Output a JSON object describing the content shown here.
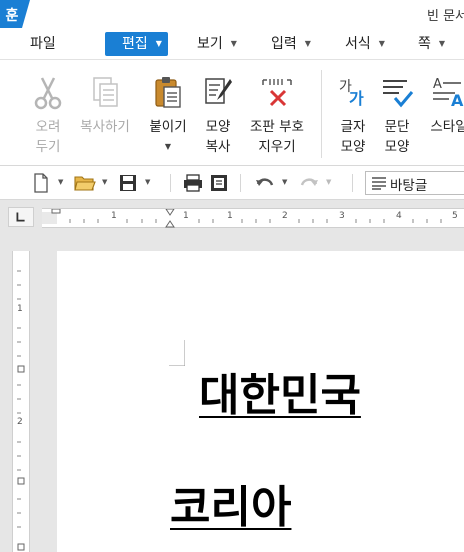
{
  "app": {
    "logo_letter": "훈",
    "window_title": "빈 문서"
  },
  "menu": {
    "items": [
      {
        "label": "파일",
        "has_caret": false
      },
      {
        "label": "편집",
        "has_caret": true,
        "active": true
      },
      {
        "label": "보기",
        "has_caret": true
      },
      {
        "label": "입력",
        "has_caret": true
      },
      {
        "label": "서식",
        "has_caret": true
      },
      {
        "label": "쪽",
        "has_caret": true
      }
    ]
  },
  "ribbon": {
    "buttons": [
      {
        "label": "오려\n두기",
        "icon": "scissors-icon",
        "disabled": true,
        "dropdown": false
      },
      {
        "label": "복사하기",
        "icon": "copy-icon",
        "disabled": true,
        "dropdown": false
      },
      {
        "label": "붙이기",
        "icon": "paste-icon",
        "disabled": false,
        "dropdown": true
      },
      {
        "label": "모양\n복사",
        "icon": "format-painter-icon",
        "disabled": false,
        "dropdown": false
      },
      {
        "label": "조판 부호\n지우기",
        "icon": "remove-codes-icon",
        "disabled": false,
        "dropdown": false
      },
      {
        "label": "글자\n모양",
        "icon": "char-shape-icon",
        "disabled": false,
        "dropdown": false
      },
      {
        "label": "문단\n모양",
        "icon": "para-shape-icon",
        "disabled": false,
        "dropdown": false
      },
      {
        "label": "스타일",
        "icon": "style-icon",
        "disabled": false,
        "dropdown": false
      }
    ]
  },
  "toolbar": {
    "style_value": "바탕글",
    "buttons": [
      "new-document-icon",
      "open-folder-icon",
      "save-icon",
      "print-icon",
      "preview-icon",
      "undo-icon",
      "redo-icon"
    ]
  },
  "ruler": {
    "h_numbers": [
      "1",
      "1",
      "1",
      "2",
      "3",
      "4",
      "5"
    ],
    "v_numbers": [
      "1",
      "2"
    ]
  },
  "document": {
    "lines": [
      "대한민국",
      "코리아"
    ]
  },
  "colors": {
    "accent": "#1a7fd4",
    "disabled_text": "#a9a9a9",
    "workspace": "#e6e6e6",
    "red_mark": "#d93636"
  }
}
